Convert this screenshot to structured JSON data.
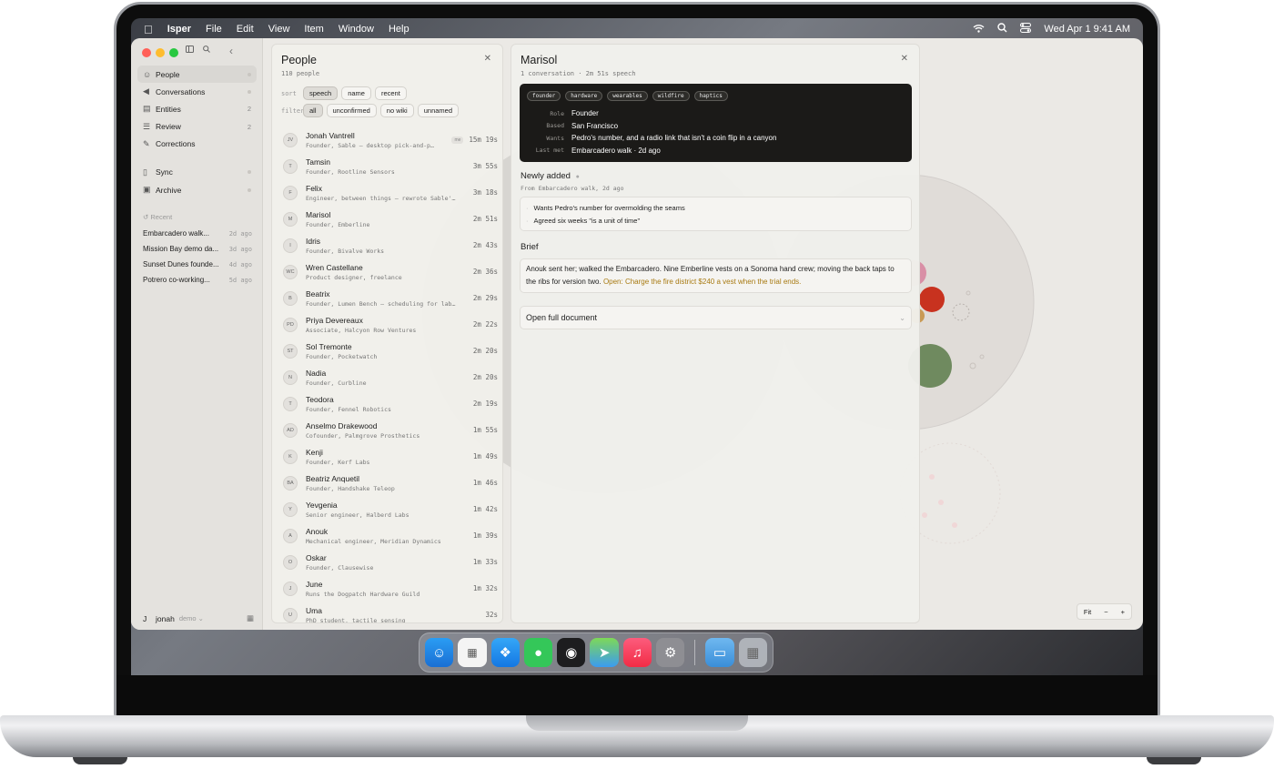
{
  "menubar": {
    "app": "Isper",
    "menus": [
      "File",
      "Edit",
      "View",
      "Item",
      "Window",
      "Help"
    ],
    "clock": "Wed Apr 1  9:41 AM"
  },
  "sidebar": {
    "nav": [
      {
        "label": "People",
        "icon": "people-icon",
        "count": ""
      },
      {
        "label": "Conversations",
        "icon": "conversations-icon",
        "count": ""
      },
      {
        "label": "Entities",
        "icon": "entities-icon",
        "count": "2"
      },
      {
        "label": "Review",
        "icon": "review-icon",
        "count": "2"
      },
      {
        "label": "Corrections",
        "icon": "pencil-icon",
        "count": ""
      },
      {
        "label": "Sync",
        "icon": "sync-icon",
        "count": ""
      },
      {
        "label": "Archive",
        "icon": "archive-icon",
        "count": ""
      }
    ],
    "recent_label": "Recent",
    "recent": [
      {
        "title": "Embarcadero walk...",
        "time": "2d ago"
      },
      {
        "title": "Mission Bay demo da...",
        "time": "3d ago"
      },
      {
        "title": "Sunset Dunes founde...",
        "time": "4d ago"
      },
      {
        "title": "Potrero co-working...",
        "time": "5d ago"
      }
    ],
    "user": {
      "initial": "J",
      "name": "jonah",
      "workspace": "demo"
    }
  },
  "people": {
    "title": "People",
    "count": "110 people",
    "sort_label": "sort",
    "sort_options": [
      "speech",
      "name",
      "recent"
    ],
    "filter_label": "filter",
    "filter_options": [
      "all",
      "unconfirmed",
      "no wiki",
      "unnamed"
    ],
    "rows": [
      {
        "initials": "JV",
        "name": "Jonah Vantrell",
        "sub": "Founder, Sable — desktop pick-and-p…",
        "time": "15m 19s",
        "badge": "me"
      },
      {
        "initials": "T",
        "name": "Tamsin",
        "sub": "Founder, Rootline Sensors",
        "time": "3m 55s"
      },
      {
        "initials": "F",
        "name": "Felix",
        "sub": "Engineer, between things — rewrote Sable'…",
        "time": "3m 18s"
      },
      {
        "initials": "M",
        "name": "Marisol",
        "sub": "Founder, Emberline",
        "time": "2m 51s"
      },
      {
        "initials": "I",
        "name": "Idris",
        "sub": "Founder, Bivalve Works",
        "time": "2m 43s"
      },
      {
        "initials": "WC",
        "name": "Wren Castellane",
        "sub": "Product designer, freelance",
        "time": "2m 36s"
      },
      {
        "initials": "B",
        "name": "Beatrix",
        "sub": "Founder, Lumen Bench — scheduling for lab…",
        "time": "2m 29s"
      },
      {
        "initials": "PD",
        "name": "Priya Devereaux",
        "sub": "Associate, Halcyon Row Ventures",
        "time": "2m 22s"
      },
      {
        "initials": "ST",
        "name": "Sol Tremonte",
        "sub": "Founder, Pocketwatch",
        "time": "2m 20s"
      },
      {
        "initials": "N",
        "name": "Nadia",
        "sub": "Founder, Curbline",
        "time": "2m 20s"
      },
      {
        "initials": "T",
        "name": "Teodora",
        "sub": "Founder, Fennel Robotics",
        "time": "2m 19s"
      },
      {
        "initials": "AD",
        "name": "Anselmo Drakewood",
        "sub": "Cofounder, Palmgrove Prosthetics",
        "time": "1m 55s"
      },
      {
        "initials": "K",
        "name": "Kenji",
        "sub": "Founder, Kerf Labs",
        "time": "1m 49s"
      },
      {
        "initials": "BA",
        "name": "Beatriz Anquetil",
        "sub": "Founder, Handshake Teleop",
        "time": "1m 46s"
      },
      {
        "initials": "Y",
        "name": "Yevgenia",
        "sub": "Senior engineer, Halberd Labs",
        "time": "1m 42s"
      },
      {
        "initials": "A",
        "name": "Anouk",
        "sub": "Mechanical engineer, Meridian Dynamics",
        "time": "1m 39s"
      },
      {
        "initials": "O",
        "name": "Oskar",
        "sub": "Founder, Clausewise",
        "time": "1m 33s"
      },
      {
        "initials": "J",
        "name": "June",
        "sub": "Runs the Dogpatch Hardware Guild",
        "time": "1m 32s"
      },
      {
        "initials": "U",
        "name": "Uma",
        "sub": "PhD student, tactile sensing",
        "time": "32s"
      }
    ]
  },
  "detail": {
    "name": "Marisol",
    "meta": "1 conversation · 2m 51s speech",
    "tags": [
      "founder",
      "hardware",
      "wearables",
      "wildfire",
      "haptics"
    ],
    "facts": [
      {
        "key": "Role",
        "value": "Founder"
      },
      {
        "key": "Based",
        "value": "San Francisco"
      },
      {
        "key": "Wants",
        "value": "Pedro's number, and a radio link that isn't a coin flip in a canyon"
      },
      {
        "key": "Last met",
        "value": "Embarcadero walk · 2d ago"
      }
    ],
    "newly_added_title": "Newly added",
    "newly_added_sub": "From Embarcadero walk, 2d ago",
    "newly_added": [
      "Wants Pedro's number for overmolding the seams",
      "Agreed six weeks \"is a unit of time\""
    ],
    "brief_title": "Brief",
    "brief_text": "Anouk sent her; walked the Embarcadero. Nine Emberline vests on a Sonoma hand crew; moving the back taps to the ribs for version two.",
    "brief_open": "Open: Charge the fire district $240 a vest when the trial ends.",
    "open_doc_label": "Open full document"
  },
  "zoom": {
    "fit": "Fit",
    "minus": "−",
    "plus": "+"
  },
  "colors": {
    "accent_open": "#a87a12",
    "card_bg": "#1b1a18"
  }
}
